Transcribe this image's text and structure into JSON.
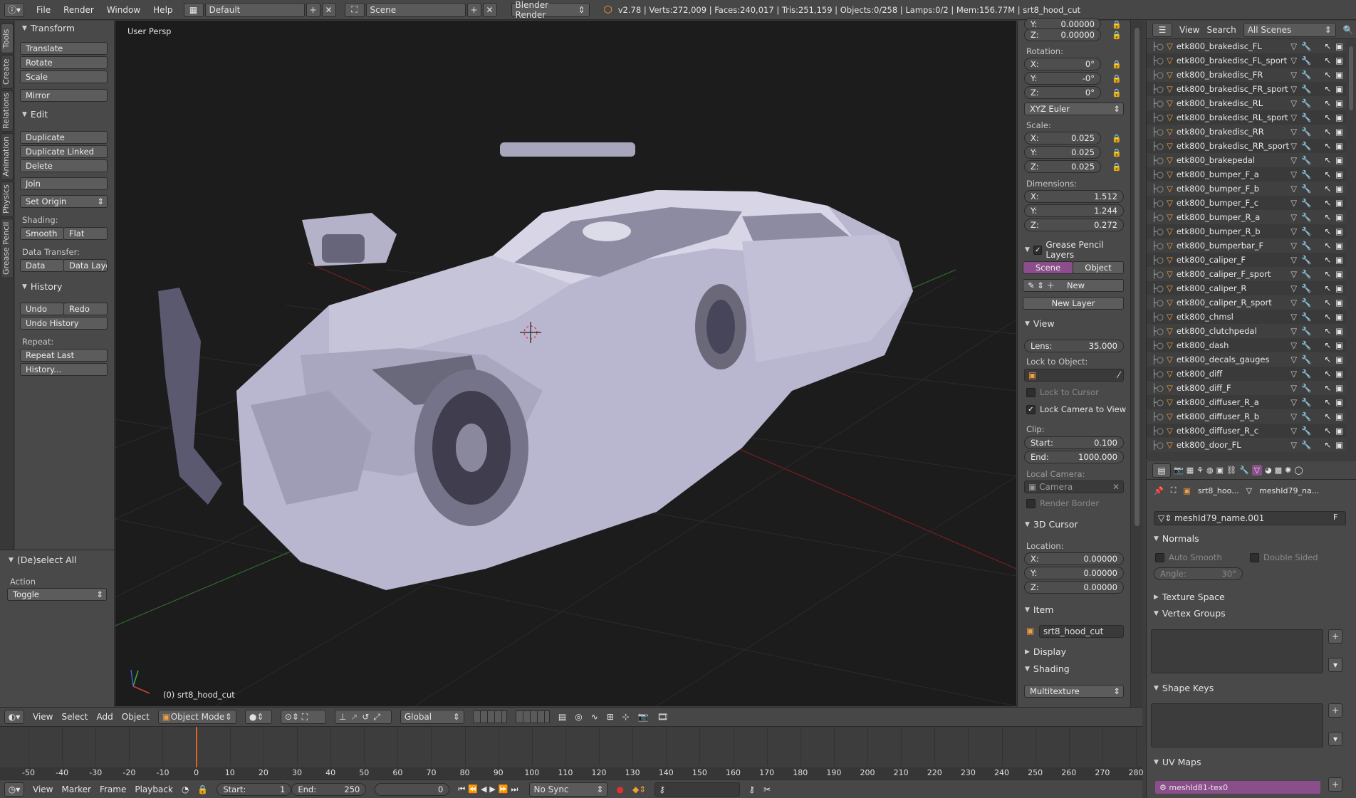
{
  "topbar": {
    "menus": [
      "File",
      "Render",
      "Window",
      "Help"
    ],
    "screen_layout": "Default",
    "scene": "Scene",
    "render_engine": "Blender Render",
    "stats": "v2.78 | Verts:272,009 | Faces:240,017 | Tris:251,159 | Objects:0/258 | Lamps:0/2 | Mem:156.77M | srt8_hood_cut"
  },
  "left_tabs": [
    "Tools",
    "Create",
    "Relations",
    "Animation",
    "Physics",
    "Grease Pencil"
  ],
  "toolshelf": {
    "transform_title": "Transform",
    "translate": "Translate",
    "rotate": "Rotate",
    "scale": "Scale",
    "mirror": "Mirror",
    "edit_title": "Edit",
    "duplicate": "Duplicate",
    "duplicate_linked": "Duplicate Linked",
    "delete": "Delete",
    "join": "Join",
    "set_origin": "Set Origin",
    "shading_label": "Shading:",
    "smooth": "Smooth",
    "flat": "Flat",
    "data_transfer_label": "Data Transfer:",
    "data": "Data",
    "data_layout": "Data Layo",
    "history_title": "History",
    "undo": "Undo",
    "redo": "Redo",
    "undo_history": "Undo History",
    "repeat_label": "Repeat:",
    "repeat_last": "Repeat Last",
    "history_btn": "History...",
    "operator_title": "(De)select All",
    "action_label": "Action",
    "action_value": "Toggle"
  },
  "viewport": {
    "view_label": "User Persp",
    "object_label": "(0) srt8_hood_cut"
  },
  "properties": {
    "loc_y": "0.00000",
    "loc_z": "0.00000",
    "rotation_label": "Rotation:",
    "rot_x": "0°",
    "rot_y": "-0°",
    "rot_z": "0°",
    "rotation_mode": "XYZ Euler",
    "scale_label": "Scale:",
    "scale_x": "0.025",
    "scale_y": "0.025",
    "scale_z": "0.025",
    "dimensions_label": "Dimensions:",
    "dim_x": "1.512",
    "dim_y": "1.244",
    "dim_z": "0.272",
    "grease_pencil_title": "Grease Pencil Layers",
    "gp_scene": "Scene",
    "gp_object": "Object",
    "gp_new": "New",
    "gp_new_layer": "New Layer",
    "view_title": "View",
    "lens_label": "Lens:",
    "lens_value": "35.000",
    "lock_to_object_label": "Lock to Object:",
    "lock_to_cursor": "Lock to Cursor",
    "lock_camera": "Lock Camera to View",
    "clip_label": "Clip:",
    "clip_start_label": "Start:",
    "clip_start": "0.100",
    "clip_end_label": "End:",
    "clip_end": "1000.000",
    "local_camera_label": "Local Camera:",
    "local_camera": "Camera",
    "render_border": "Render Border",
    "cursor_title": "3D Cursor",
    "location_label": "Location:",
    "cur_x": "0.00000",
    "cur_y": "0.00000",
    "cur_z": "0.00000",
    "item_title": "Item",
    "item_name": "srt8_hood_cut",
    "display_title": "Display",
    "shading_title": "Shading",
    "shading_mode": "Multitexture",
    "x": "X:",
    "y": "Y:",
    "z": "Z:"
  },
  "outliner": {
    "view": "View",
    "search": "Search",
    "filter": "All Scenes",
    "items": [
      "etk800_brakedisc_FL",
      "etk800_brakedisc_FL_sport",
      "etk800_brakedisc_FR",
      "etk800_brakedisc_FR_sport",
      "etk800_brakedisc_RL",
      "etk800_brakedisc_RL_sport",
      "etk800_brakedisc_RR",
      "etk800_brakedisc_RR_sport",
      "etk800_brakepedal",
      "etk800_bumper_F_a",
      "etk800_bumper_F_b",
      "etk800_bumper_F_c",
      "etk800_bumper_R_a",
      "etk800_bumper_R_b",
      "etk800_bumperbar_F",
      "etk800_caliper_F",
      "etk800_caliper_F_sport",
      "etk800_caliper_R",
      "etk800_caliper_R_sport",
      "etk800_chmsl",
      "etk800_clutchpedal",
      "etk800_dash",
      "etk800_decals_gauges",
      "etk800_diff",
      "etk800_diff_F",
      "etk800_diffuser_R_a",
      "etk800_diffuser_R_b",
      "etk800_diffuser_R_c",
      "etk800_door_FL"
    ]
  },
  "property_editor": {
    "crumb_object": "srt8_hoo...",
    "crumb_mesh": "meshId79_na...",
    "mesh_name": "meshId79_name.001",
    "fake_user": "F",
    "normals_title": "Normals",
    "auto_smooth": "Auto Smooth",
    "double_sided": "Double Sided",
    "angle_label": "Angle:",
    "angle_value": "30°",
    "texture_space": "Texture Space",
    "vertex_groups": "Vertex Groups",
    "shape_keys": "Shape Keys",
    "uv_maps": "UV Maps",
    "uv_map_name": "meshId81-tex0"
  },
  "viewport_header": {
    "view": "View",
    "select": "Select",
    "add": "Add",
    "object": "Object",
    "mode": "Object Mode",
    "orientation": "Global"
  },
  "timeline": {
    "ticks": [
      "-50",
      "-40",
      "-30",
      "-20",
      "-10",
      "0",
      "10",
      "20",
      "30",
      "40",
      "50",
      "60",
      "70",
      "80",
      "90",
      "100",
      "110",
      "120",
      "130",
      "140",
      "150",
      "160",
      "170",
      "180",
      "190",
      "200",
      "210",
      "220",
      "230",
      "240",
      "250",
      "260",
      "270",
      "280"
    ],
    "current_frame_value": 0
  },
  "timeline_header": {
    "view": "View",
    "marker": "Marker",
    "frame": "Frame",
    "playback": "Playback",
    "start_label": "Start:",
    "start": "1",
    "end_label": "End:",
    "end": "250",
    "current": "0",
    "sync": "No Sync"
  }
}
